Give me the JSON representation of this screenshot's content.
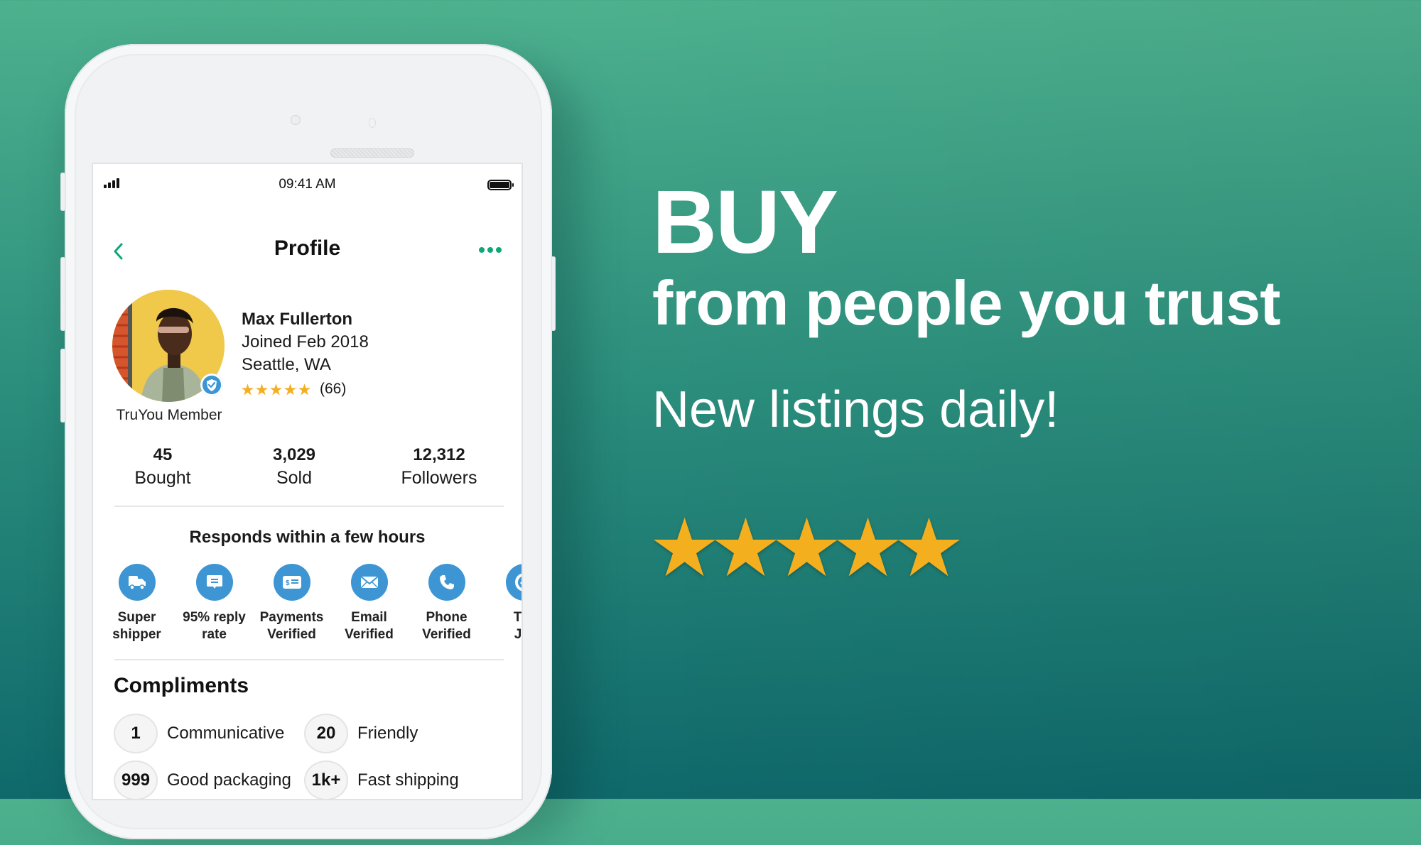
{
  "colors": {
    "accent_green": "#0fa678",
    "badge_blue": "#3d96d3",
    "star_gold": "#f4af1f",
    "bg_top": "#4db18e",
    "bg_bottom": "#0f696b"
  },
  "promo": {
    "headline": "BUY",
    "subheadline": "from people you trust",
    "tagline": "New listings daily!",
    "rating_stars": 5
  },
  "phone": {
    "status_bar": {
      "time": "09:41 AM",
      "signal_icon": "signal-icon",
      "battery_icon": "battery-icon"
    },
    "nav": {
      "title": "Profile",
      "back_icon": "chevron-left-icon",
      "more_icon": "more-dots-icon"
    },
    "profile": {
      "name": "Max Fullerton",
      "joined": "Joined Feb 2018",
      "location": "Seattle, WA",
      "rating_stars": 5,
      "rating_count": "(66)",
      "member_label": "TruYou Member",
      "verified_icon": "verified-check-icon"
    },
    "stats": [
      {
        "value": "45",
        "label": "Bought"
      },
      {
        "value": "3,029",
        "label": "Sold"
      },
      {
        "value": "12,312",
        "label": "Followers"
      }
    ],
    "responds_text": "Responds within a few hours",
    "badges": [
      {
        "icon": "truck-icon",
        "line1": "Super",
        "line2": "shipper"
      },
      {
        "icon": "chat-bubble-icon",
        "line1": "95% reply",
        "line2": "rate"
      },
      {
        "icon": "payment-card-icon",
        "line1": "Payments",
        "line2": "Verified"
      },
      {
        "icon": "envelope-icon",
        "line1": "Email",
        "line2": "Verified"
      },
      {
        "icon": "phone-icon",
        "line1": "Phone",
        "line2": "Verified"
      },
      {
        "icon": "shield-check-icon",
        "line1": "Tru",
        "line2": "Joi"
      }
    ],
    "compliments_title": "Compliments",
    "compliments": [
      {
        "count": "1",
        "label": "Communicative"
      },
      {
        "count": "20",
        "label": "Friendly"
      },
      {
        "count": "999",
        "label": "Good packaging"
      },
      {
        "count": "1k+",
        "label": "Fast shipping"
      }
    ]
  }
}
